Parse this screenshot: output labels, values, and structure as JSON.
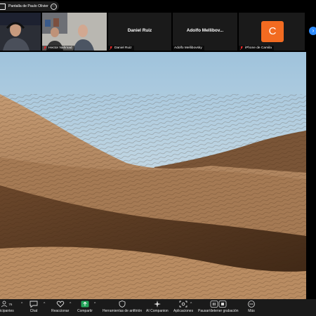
{
  "share_bar": {
    "label": "Pantalla de Paulo Olivier"
  },
  "participants": [
    {
      "name": "",
      "type": "video"
    },
    {
      "name": "Hector Nahmad",
      "type": "video"
    },
    {
      "name": "Daniel Ruiz",
      "display": "Daniel Ruiz",
      "type": "name"
    },
    {
      "name": "Adolfo Mellibovsky",
      "display": "Adolfo  Mellibov...",
      "type": "name"
    },
    {
      "name": "iPhone de Camila",
      "initial": "C",
      "type": "avatar"
    }
  ],
  "toolbar": {
    "participants_label": "icipantes",
    "participants_count": "76",
    "items": {
      "chat": "Chat",
      "reactions": "Reaccionar",
      "share": "Compartir",
      "host_tools": "Herramientas de anfitrión",
      "ai_companion": "AI Companion",
      "apps": "Aplicaciones",
      "record": "Pausar/detener grabación",
      "more": "Más"
    }
  },
  "colors": {
    "avatar": "#f26b21",
    "share_green": "#23a55a",
    "accent_blue": "#2d8cff",
    "record_red": "#e02828"
  }
}
